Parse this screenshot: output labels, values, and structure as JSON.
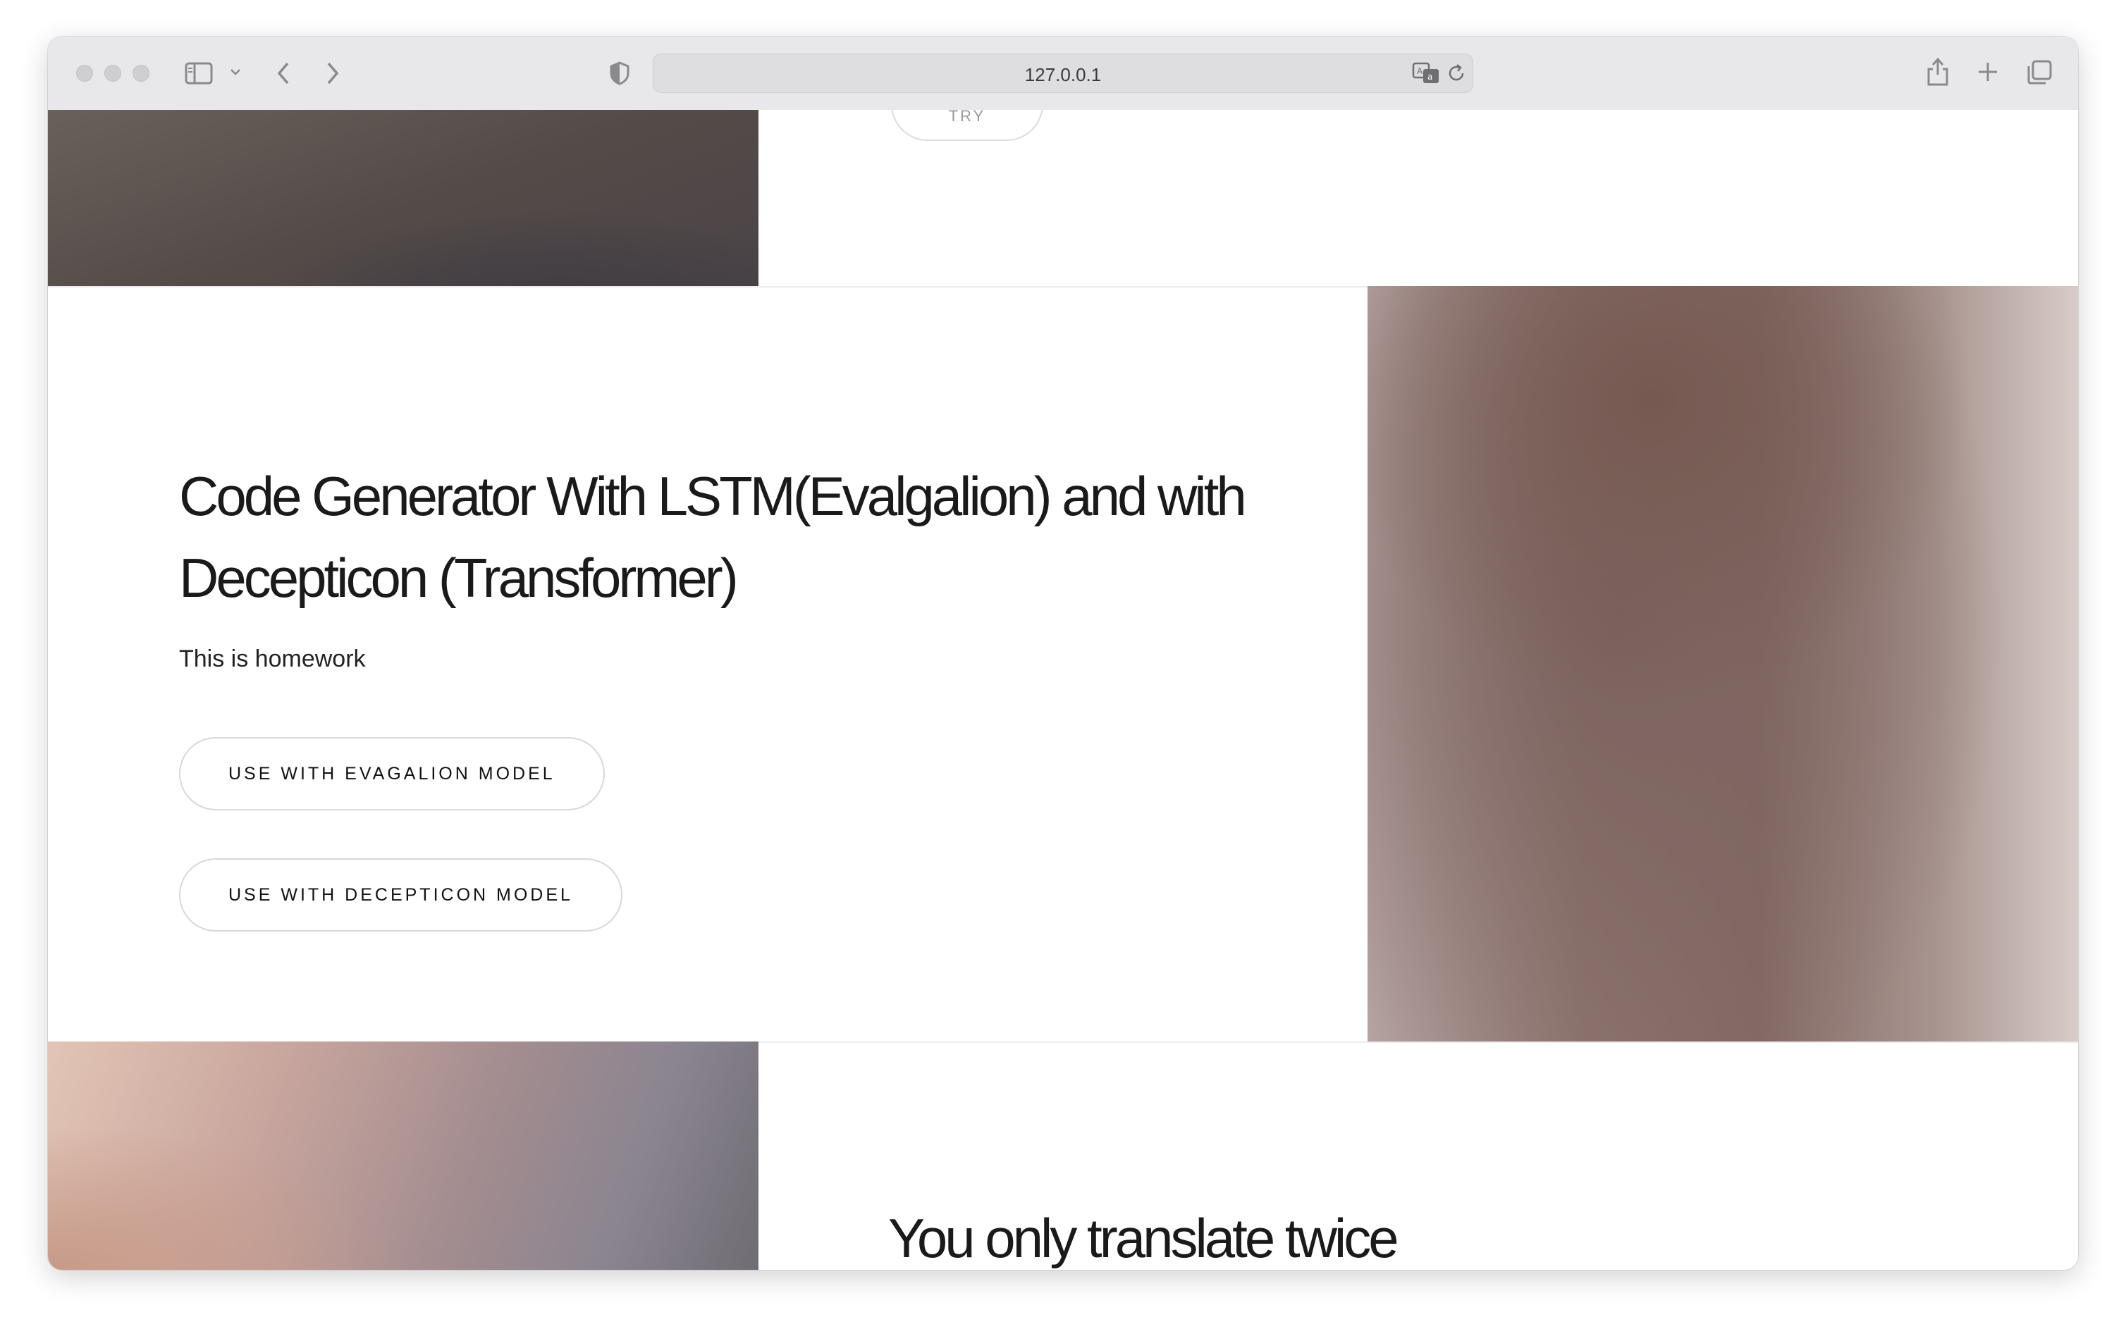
{
  "browser": {
    "url": "127.0.0.1",
    "icons": {
      "sidebar": "sidebar-icon",
      "back": "chevron-left-icon",
      "forward": "chevron-right-icon",
      "shield": "shield-icon",
      "translate": "translate-icon",
      "reload": "reload-icon",
      "share": "share-icon",
      "new_tab": "plus-icon",
      "tabs": "tabs-overview-icon"
    }
  },
  "page": {
    "top_partial_button": "TRY",
    "section_code_generator": {
      "title": "Code Generator With LSTM(Evalgalion) and with Decepticon (Transformer)",
      "description": "This is homework",
      "buttons": [
        {
          "label": "USE WITH EVAGALION MODEL"
        },
        {
          "label": "USE WITH DECEPTICON MODEL"
        }
      ]
    },
    "section_translate": {
      "title": "You only translate twice"
    }
  }
}
